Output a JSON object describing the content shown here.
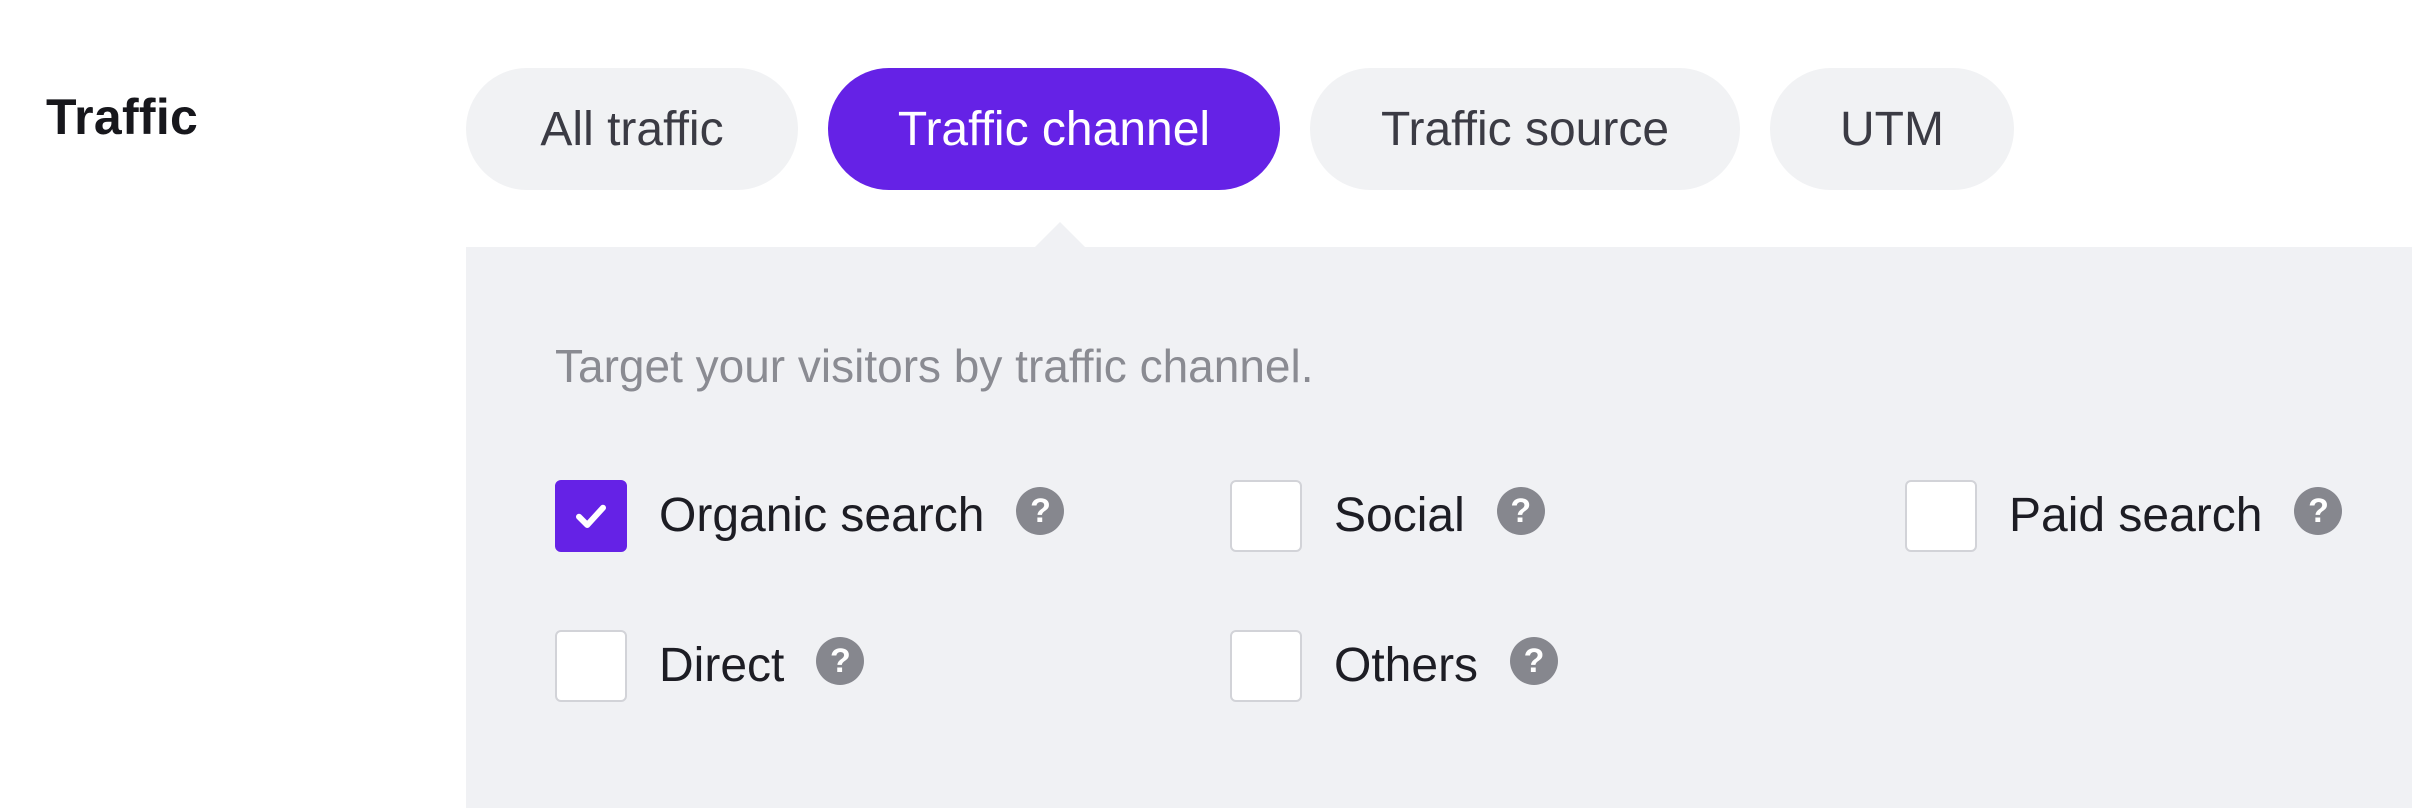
{
  "section": {
    "title": "Traffic"
  },
  "tabs": [
    {
      "label": "All traffic",
      "active": false
    },
    {
      "label": "Traffic channel",
      "active": true
    },
    {
      "label": "Traffic source",
      "active": false
    },
    {
      "label": "UTM",
      "active": false
    }
  ],
  "panel": {
    "description": "Target your visitors by traffic channel.",
    "options": [
      {
        "label": "Organic search",
        "checked": true,
        "help_icon": "question-icon"
      },
      {
        "label": "Social",
        "checked": false,
        "help_icon": "question-icon"
      },
      {
        "label": "Paid search",
        "checked": false,
        "help_icon": "question-icon"
      },
      {
        "label": "Direct",
        "checked": false,
        "help_icon": "question-icon"
      },
      {
        "label": "Others",
        "checked": false,
        "help_icon": "question-icon"
      }
    ],
    "help_glyph": "?"
  },
  "colors": {
    "accent": "#6522e6",
    "tab_bg": "#f1f2f4",
    "panel_bg": "#f0f1f4",
    "help_icon_bg": "#86878e",
    "muted_text": "#8a8b92"
  }
}
